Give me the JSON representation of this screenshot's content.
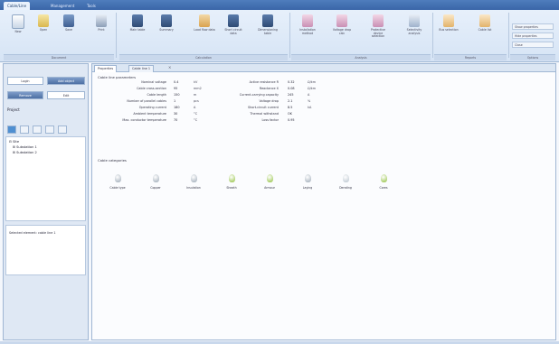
{
  "ribbon": {
    "tabs": [
      {
        "label": "Cable/Line",
        "active": true
      },
      {
        "label": "Management",
        "active": false
      },
      {
        "label": "Tools",
        "active": false
      }
    ],
    "buttons": [
      {
        "label": "New",
        "icon": "new-file-icon"
      },
      {
        "label": "Open",
        "icon": "open-folder-icon"
      },
      {
        "label": "Save",
        "icon": "save-icon"
      },
      {
        "label": "Print",
        "icon": "print-icon"
      },
      {
        "label": "Main table",
        "icon": "table-icon"
      },
      {
        "label": "Summary",
        "icon": "summary-icon"
      },
      {
        "label": "Load flow data",
        "icon": "load-flow-icon"
      },
      {
        "label": "Short circuit data",
        "icon": "short-circuit-icon"
      },
      {
        "label": "Dimensioning table",
        "icon": "dimension-icon"
      },
      {
        "label": "Installation method",
        "icon": "installation-icon"
      },
      {
        "label": "Voltage drop calc",
        "icon": "voltage-drop-icon"
      },
      {
        "label": "Protective device selection",
        "icon": "protection-icon"
      },
      {
        "label": "Selectivity analysis",
        "icon": "selectivity-icon"
      },
      {
        "label": "Bus selection",
        "icon": "bus-icon"
      },
      {
        "label": "Cable list",
        "icon": "cable-list-icon"
      }
    ],
    "groups": [
      "Document",
      "Calculation",
      "Analysis",
      "Reports",
      "Options"
    ],
    "mini_buttons": [
      "Show properties",
      "Hide properties",
      "Close"
    ]
  },
  "left_panel": {
    "buttons": [
      "Login",
      "Add object",
      "Remove",
      "Edit"
    ],
    "project_label": "Project",
    "tree": [
      "Site",
      "Substation 1",
      "Substation 2"
    ],
    "info_text": "Selected element: cable line 1"
  },
  "main": {
    "doc_tabs": [
      "Properties",
      "Cable line 1"
    ],
    "section_title": "Cable line parameters",
    "params_left": [
      {
        "label": "Nominal voltage",
        "value": "0.4",
        "unit": "kV"
      },
      {
        "label": "Cable cross-section",
        "value": "95",
        "unit": "mm2"
      },
      {
        "label": "Cable length",
        "value": "150",
        "unit": "m"
      },
      {
        "label": "Number of parallel cables",
        "value": "1",
        "unit": "pcs"
      },
      {
        "label": "Operating current",
        "value": "180",
        "unit": "A"
      },
      {
        "label": "Ambient temperature",
        "value": "30",
        "unit": "°C"
      },
      {
        "label": "Max. conductor temperature",
        "value": "70",
        "unit": "°C"
      }
    ],
    "params_right": [
      {
        "label": "Active resistance R",
        "value": "0.32",
        "unit": "Ω/km"
      },
      {
        "label": "Reactance X",
        "value": "0.08",
        "unit": "Ω/km"
      },
      {
        "label": "Current-carrying capacity",
        "value": "245",
        "unit": "A"
      },
      {
        "label": "Voltage drop",
        "value": "2.1",
        "unit": "%"
      },
      {
        "label": "Short-circuit current",
        "value": "8.5",
        "unit": "kA"
      },
      {
        "label": "Thermal withstand",
        "value": "OK",
        "unit": ""
      },
      {
        "label": "Loss factor",
        "value": "0.95",
        "unit": ""
      }
    ],
    "categories_title": "Cable categories",
    "categories": [
      {
        "label": "Cable type",
        "color": "#9aa7b5"
      },
      {
        "label": "Copper",
        "color": "#9aa7b5"
      },
      {
        "label": "Insulation",
        "color": "#9aa7b5"
      },
      {
        "label": "Sheath",
        "color": "#8fbf3a"
      },
      {
        "label": "Armour",
        "color": "#8fbf3a"
      },
      {
        "label": "Laying",
        "color": "#9aa7b5"
      },
      {
        "label": "Derating",
        "color": "#b7c2cd"
      },
      {
        "label": "Cores",
        "color": "#8fbf3a"
      }
    ]
  }
}
